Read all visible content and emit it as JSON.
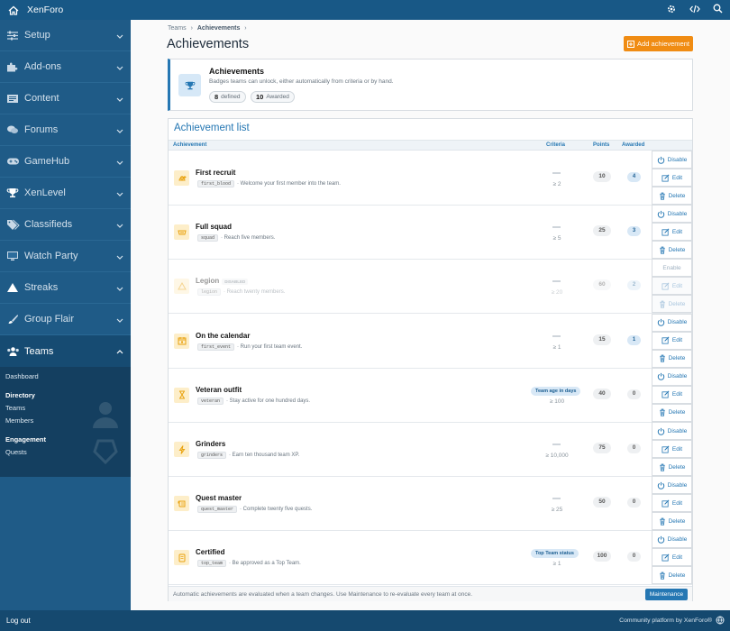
{
  "app": {
    "name": "XenForo",
    "footer_logout": "Log out",
    "footer_credit": "Community platform by XenForo®"
  },
  "icons": {
    "home": "home-icon",
    "tools": [
      "cog-icon",
      "code-icon",
      "search-icon"
    ]
  },
  "sidebar": {
    "items": [
      {
        "label": "Setup",
        "icon": "sliders-icon"
      },
      {
        "label": "Add-ons",
        "icon": "puzzle-icon"
      },
      {
        "label": "Content",
        "icon": "content-icon"
      },
      {
        "label": "Forums",
        "icon": "comments-icon"
      },
      {
        "label": "GameHub",
        "icon": "gamepad-icon"
      },
      {
        "label": "XenLevel",
        "icon": "trophy-icon"
      },
      {
        "label": "Classifieds",
        "icon": "tags-icon"
      },
      {
        "label": "Watch Party",
        "icon": "monitor-icon"
      },
      {
        "label": "Streaks",
        "icon": "triangle-icon"
      },
      {
        "label": "Group Flair",
        "icon": "brush-icon"
      },
      {
        "label": "Teams",
        "icon": "users-icon"
      }
    ],
    "teams_sub": {
      "dashboard": "Dashboard",
      "directory_header": "Directory",
      "teams": "Teams",
      "members": "Members",
      "engagement_header": "Engagement",
      "quests": "Quests"
    }
  },
  "breadcrumb": {
    "first": "Teams",
    "sep": "›",
    "second": "Achievements",
    "sep2": "›"
  },
  "page": {
    "title": "Achievements",
    "add_button": "Add achievement"
  },
  "info": {
    "title": "Achievements",
    "desc": "Badges teams can unlock, either automatically from criteria or by hand.",
    "defined_count": "8",
    "defined_label": "defined",
    "awarded_count": "10",
    "awarded_label": "Awarded"
  },
  "list": {
    "title": "Achievement list",
    "columns": {
      "achievement": "Achievement",
      "criteria": "Criteria",
      "points": "Points",
      "awarded": "Awarded"
    },
    "footer_text": "Automatic achievements are evaluated when a team changes. Use Maintenance to re-evaluate every team at once.",
    "maintenance_button": "Maintenance",
    "rows": [
      {
        "title": "First recruit",
        "code": "first_blood",
        "desc": "· Welcome your first member into the team.",
        "criteria_badge": "",
        "criteria": "≥ 2",
        "points": "10",
        "awarded": "4",
        "awarded_hi": true,
        "disabled": false,
        "action1": "Disable",
        "edit": "Edit",
        "delete": "Delete",
        "icon": "recruit-icon"
      },
      {
        "title": "Full squad",
        "code": "squad",
        "desc": "· Reach five members.",
        "criteria_badge": "",
        "criteria": "≥ 5",
        "points": "25",
        "awarded": "3",
        "awarded_hi": true,
        "disabled": false,
        "action1": "Disable",
        "edit": "Edit",
        "delete": "Delete",
        "icon": "squad-icon"
      },
      {
        "title": "Legion",
        "tag": "DISABLED",
        "code": "legion",
        "desc": "· Reach twenty members.",
        "criteria_badge": "",
        "criteria": "≥ 20",
        "points": "60",
        "awarded": "2",
        "awarded_hi": true,
        "disabled": true,
        "action1": "Enable",
        "edit": "Edit",
        "delete": "Delete",
        "icon": "legion-icon"
      },
      {
        "title": "On the calendar",
        "code": "first_event",
        "desc": "· Run your first team event.",
        "criteria_badge": "",
        "criteria": "≥ 1",
        "points": "15",
        "awarded": "1",
        "awarded_hi": true,
        "disabled": false,
        "action1": "Disable",
        "edit": "Edit",
        "delete": "Delete",
        "icon": "calendar-icon"
      },
      {
        "title": "Veteran outfit",
        "code": "veteran",
        "desc": "· Stay active for one hundred days.",
        "criteria_badge": "Team age in days",
        "criteria": "≥ 100",
        "points": "40",
        "awarded": "0",
        "awarded_hi": false,
        "disabled": false,
        "action1": "Disable",
        "edit": "Edit",
        "delete": "Delete",
        "icon": "hourglass-icon"
      },
      {
        "title": "Grinders",
        "code": "grinders",
        "desc": "· Earn ten thousand team XP.",
        "criteria_badge": "",
        "criteria": "≥ 10,000",
        "points": "75",
        "awarded": "0",
        "awarded_hi": false,
        "disabled": false,
        "action1": "Disable",
        "edit": "Edit",
        "delete": "Delete",
        "icon": "bolt-icon"
      },
      {
        "title": "Quest master",
        "code": "quest_master",
        "desc": "· Complete twenty five quests.",
        "criteria_badge": "",
        "criteria": "≥ 25",
        "points": "50",
        "awarded": "0",
        "awarded_hi": false,
        "disabled": false,
        "action1": "Disable",
        "edit": "Edit",
        "delete": "Delete",
        "icon": "scroll-icon"
      },
      {
        "title": "Certified",
        "code": "top_team",
        "desc": "· Be approved as a Top Team.",
        "criteria_badge": "Top Team status",
        "criteria": "≥ 1",
        "points": "100",
        "awarded": "0",
        "awarded_hi": false,
        "disabled": false,
        "action1": "Disable",
        "edit": "Edit",
        "delete": "Delete",
        "icon": "certificate-icon"
      }
    ]
  },
  "colors": {
    "header": "#185886",
    "sidebar": "#1f5b87",
    "accent": "#2577b3",
    "add_button": "#f08c13"
  }
}
